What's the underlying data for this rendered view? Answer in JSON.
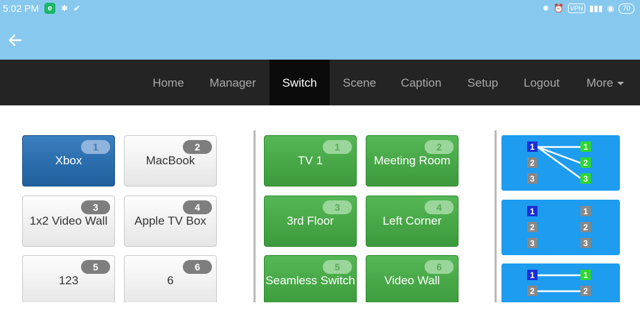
{
  "status": {
    "time": "5:02 PM",
    "app_icon": "app-notification-icon",
    "signal_icons": [
      "alarm-icon",
      "clock-icon",
      "vpn-icon",
      "cell-signal-icon",
      "wifi-icon",
      "battery-icon"
    ],
    "vpn_label": "VPN",
    "battery_label": "70"
  },
  "nav": {
    "items": [
      "Home",
      "Manager",
      "Switch",
      "Scene",
      "Caption",
      "Setup",
      "Logout",
      "More"
    ],
    "active": "Switch"
  },
  "sources": [
    {
      "label": "Xbox",
      "num": "1",
      "selected": true
    },
    {
      "label": "MacBook",
      "num": "2"
    },
    {
      "label": "1x2 Video Wall",
      "num": "3"
    },
    {
      "label": "Apple TV Box",
      "num": "4"
    },
    {
      "label": "123",
      "num": "5"
    },
    {
      "label": "6",
      "num": "6"
    }
  ],
  "outputs": [
    {
      "label": "TV 1",
      "num": "1"
    },
    {
      "label": "Meeting Room",
      "num": "2"
    },
    {
      "label": "3rd Floor",
      "num": "3"
    },
    {
      "label": "Left Corner",
      "num": "4"
    },
    {
      "label": "Seamless Switch",
      "num": "5"
    },
    {
      "label": "Video Wall",
      "num": "6"
    }
  ],
  "scenes": [
    {
      "name": "one-to-many",
      "inputs": [
        "1",
        "2",
        "3"
      ],
      "outputs": [
        "1",
        "2",
        "3"
      ]
    },
    {
      "name": "unmapped",
      "inputs": [
        "1",
        "2",
        "3"
      ],
      "outputs": [
        "1",
        "2",
        "3"
      ]
    },
    {
      "name": "one-to-one",
      "inputs": [
        "1",
        "2"
      ],
      "outputs": [
        "1",
        "2"
      ]
    }
  ],
  "colors": {
    "statusbar": "#87c8ee",
    "navbar": "#242424",
    "selected_source": "#2a6fb0",
    "output_green": "#4aa84a",
    "scene_blue": "#1d9cf0"
  }
}
